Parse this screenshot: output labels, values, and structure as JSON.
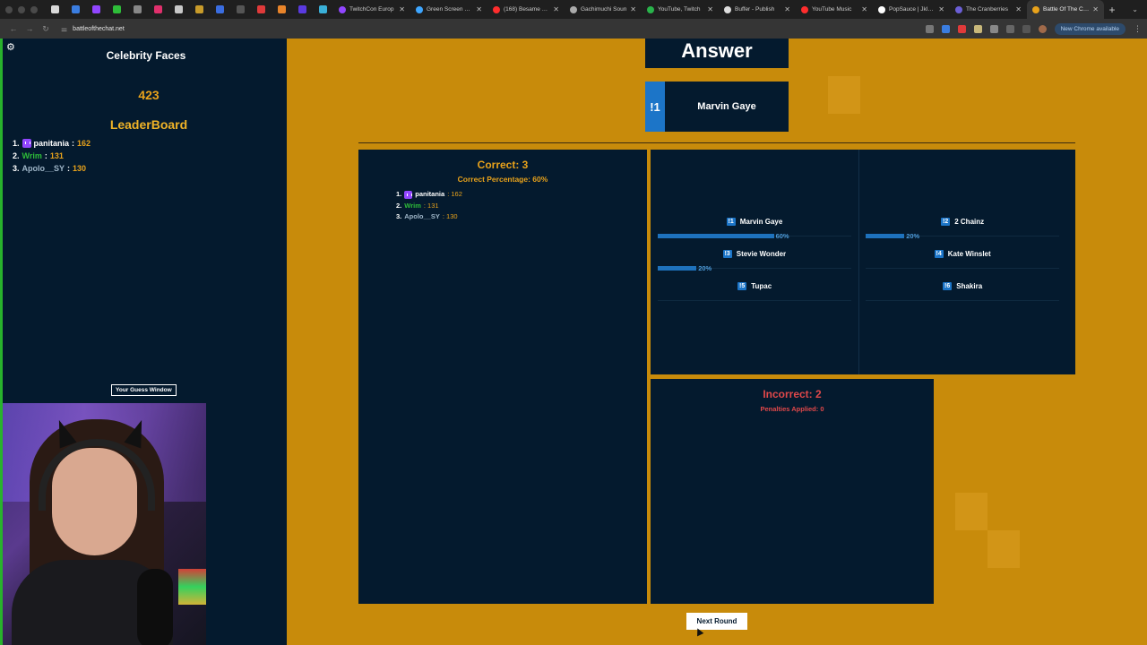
{
  "browser": {
    "tabs": [
      {
        "label": "TwitchCon Europ",
        "color": "#9146ff"
      },
      {
        "label": "Green Screen Pla",
        "color": "#3ea6ff"
      },
      {
        "label": "(168) Besame Mu",
        "color": "#ff2d2d"
      },
      {
        "label": "Gachimuchi Soun",
        "color": "#aaaaaa"
      },
      {
        "label": "YouTube, Twitch",
        "color": "#29b34b"
      },
      {
        "label": "Buffer - Publish",
        "color": "#dddddd"
      },
      {
        "label": "YouTube Music",
        "color": "#ff2d2d"
      },
      {
        "label": "PopSauce | Jklm.f",
        "color": "#ffffff"
      },
      {
        "label": "The Cranberries",
        "color": "#6b5fd6"
      },
      {
        "label": "Battle Of The Cha",
        "color": "#e8a21b",
        "active": true
      }
    ],
    "url": "battleofthechat.net",
    "new_chrome_label": "New Chrome available"
  },
  "sidebar": {
    "category": "Celebrity Faces",
    "timer": "423",
    "leaderboard_title": "LeaderBoard",
    "leaderboard": [
      {
        "rank": "1.",
        "name": "panitania",
        "score": "162",
        "color": "#ffffff",
        "badge": true
      },
      {
        "rank": "2.",
        "name": "Wrim",
        "score": "131",
        "color": "#2ebd39",
        "badge": false
      },
      {
        "rank": "3.",
        "name": "Apolo__SY",
        "score": "130",
        "color": "#9fb6c8",
        "badge": false
      }
    ],
    "guess_window_label": "Your Guess Window"
  },
  "answer": {
    "heading": "Answer",
    "command": "!1",
    "name": "Marvin Gaye"
  },
  "correct": {
    "title": "Correct: 3",
    "percentage": "Correct Percentage: 60%",
    "list": [
      {
        "rank": "1.",
        "name": "panitania",
        "score": ": 162",
        "color": "#ffffff",
        "badge": true
      },
      {
        "rank": "2.",
        "name": "Wrim",
        "score": ": 131",
        "color": "#2ebd39",
        "badge": false
      },
      {
        "rank": "3.",
        "name": "Apolo__SY",
        "score": ": 130",
        "color": "#9fb6c8",
        "badge": false
      }
    ]
  },
  "options": [
    {
      "cmd": "!1",
      "name": "Marvin Gaye",
      "pct": "60%",
      "value": 0.6
    },
    {
      "cmd": "!2",
      "name": "2 Chainz",
      "pct": "20%",
      "value": 0.2
    },
    {
      "cmd": "!3",
      "name": "Stevie Wonder",
      "pct": "20%",
      "value": 0.2
    },
    {
      "cmd": "!4",
      "name": "Kate Winslet",
      "pct": "",
      "value": 0
    },
    {
      "cmd": "!5",
      "name": "Tupac",
      "pct": "",
      "value": 0
    },
    {
      "cmd": "!6",
      "name": "Shakira",
      "pct": "",
      "value": 0
    }
  ],
  "incorrect": {
    "title": "Incorrect: 2",
    "penalties": "Penalties Applied: 0"
  },
  "next_round_label": "Next Round",
  "colors": {
    "page_bg": "#c88b0b",
    "panel_bg": "#041a2e",
    "accent_gold": "#e8a21b",
    "accent_blue": "#1c75c8",
    "incorrect_red": "#e0484a"
  }
}
